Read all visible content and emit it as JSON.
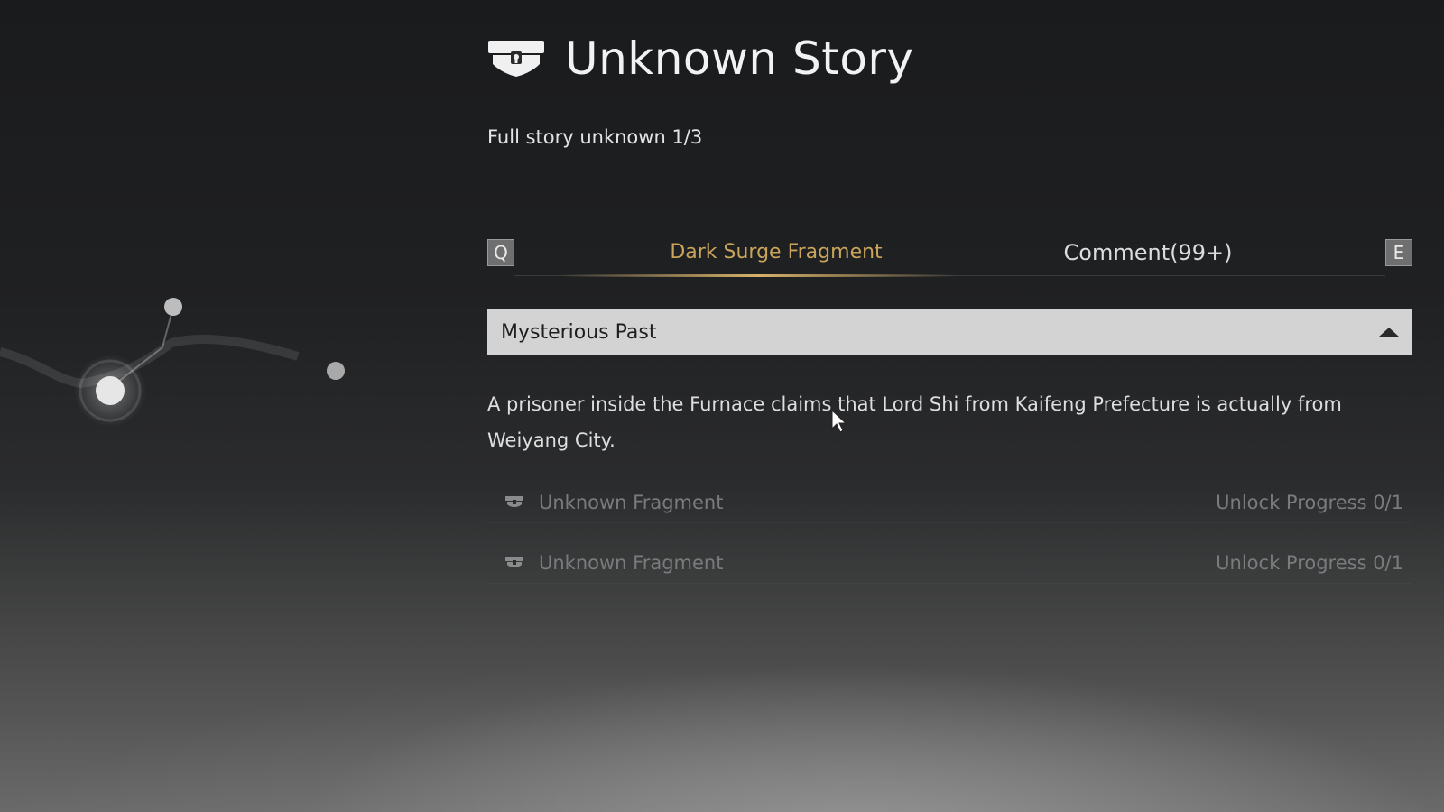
{
  "header": {
    "title": "Unknown Story",
    "icon": "locked-chest-icon",
    "subtitle": "Full story unknown 1/3"
  },
  "tabs": {
    "prev_key": "Q",
    "next_key": "E",
    "items": [
      {
        "label": "Dark Surge Fragment",
        "active": true
      },
      {
        "label": "Comment(99+)",
        "active": false
      }
    ]
  },
  "section": {
    "title": "Mysterious Past",
    "expanded": true,
    "description": "A prisoner inside the Furnace claims that Lord Shi from Kaifeng Prefecture is actually from Weiyang City."
  },
  "fragments": [
    {
      "label": "Unknown Fragment",
      "progress": "Unlock Progress 0/1",
      "icon": "locked-chest-icon"
    },
    {
      "label": "Unknown Fragment",
      "progress": "Unlock Progress 0/1",
      "icon": "locked-chest-icon"
    }
  ],
  "colors": {
    "accent": "#c9a45a",
    "accordion_bg": "#d3d3d3",
    "locked_text": "#7a7b7d"
  }
}
